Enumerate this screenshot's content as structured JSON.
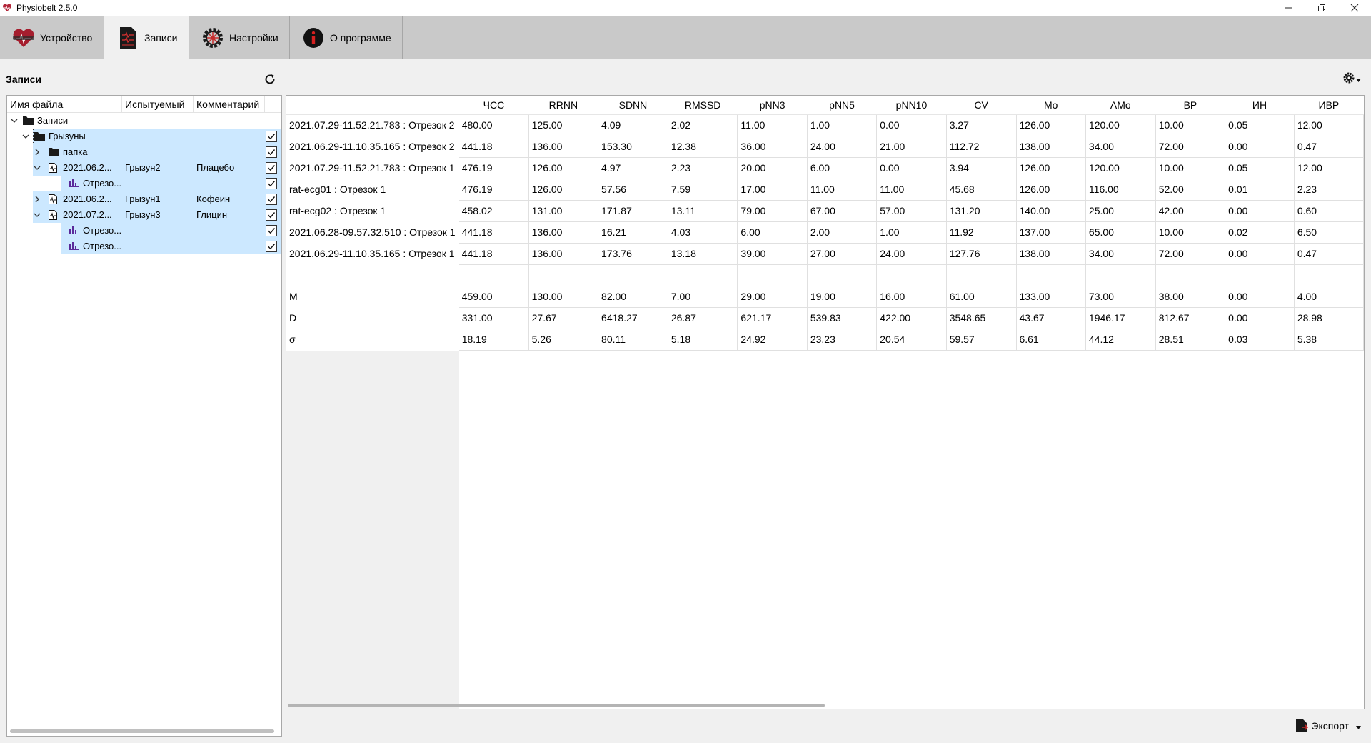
{
  "window": {
    "title": "Physiobelt 2.5.0"
  },
  "tabs": [
    {
      "label": "Устройство",
      "icon": "heart-icon",
      "active": false
    },
    {
      "label": "Записи",
      "icon": "ecg-document-icon",
      "active": true
    },
    {
      "label": "Настройки",
      "icon": "gear-wheel-icon",
      "active": false
    },
    {
      "label": "О программе",
      "icon": "info-icon",
      "active": false
    }
  ],
  "left": {
    "title": "Записи",
    "columns": [
      "Имя файла",
      "Испытуемый",
      "Комментарий"
    ],
    "rows": [
      {
        "name": "Записи",
        "subject": "",
        "comment": ""
      },
      {
        "name": "Грызуны",
        "subject": "",
        "comment": ""
      },
      {
        "name": "папка",
        "subject": "",
        "comment": ""
      },
      {
        "name": "2021.06.2...",
        "subject": "Грызун2",
        "comment": "Плацебо"
      },
      {
        "name": "Отрезо...",
        "subject": "",
        "comment": ""
      },
      {
        "name": "2021.06.2...",
        "subject": "Грызун1",
        "comment": "Кофеин"
      },
      {
        "name": "2021.07.2...",
        "subject": "Грызун3",
        "comment": "Глицин"
      },
      {
        "name": "Отрезо...",
        "subject": "",
        "comment": ""
      },
      {
        "name": "Отрезо...",
        "subject": "",
        "comment": ""
      }
    ]
  },
  "grid": {
    "columns": [
      "ЧСС",
      "RRNN",
      "SDNN",
      "RMSSD",
      "pNN3",
      "pNN5",
      "pNN10",
      "CV",
      "Mo",
      "AMo",
      "ВР",
      "ИН",
      "ИВР"
    ],
    "rows": [
      {
        "label": "2021.07.29-11.52.21.783 : Отрезок 2",
        "values": [
          "480.00",
          "125.00",
          "4.09",
          "2.02",
          "11.00",
          "1.00",
          "0.00",
          "3.27",
          "126.00",
          "120.00",
          "10.00",
          "0.05",
          "12.00"
        ]
      },
      {
        "label": "2021.06.29-11.10.35.165 : Отрезок 2",
        "values": [
          "441.18",
          "136.00",
          "153.30",
          "12.38",
          "36.00",
          "24.00",
          "21.00",
          "112.72",
          "138.00",
          "34.00",
          "72.00",
          "0.00",
          "0.47"
        ]
      },
      {
        "label": "2021.07.29-11.52.21.783 : Отрезок 1",
        "values": [
          "476.19",
          "126.00",
          "4.97",
          "2.23",
          "20.00",
          "6.00",
          "0.00",
          "3.94",
          "126.00",
          "120.00",
          "10.00",
          "0.05",
          "12.00"
        ]
      },
      {
        "label": "rat-ecg01 : Отрезок 1",
        "values": [
          "476.19",
          "126.00",
          "57.56",
          "7.59",
          "17.00",
          "11.00",
          "11.00",
          "45.68",
          "126.00",
          "116.00",
          "52.00",
          "0.01",
          "2.23"
        ]
      },
      {
        "label": "rat-ecg02 : Отрезок 1",
        "values": [
          "458.02",
          "131.00",
          "171.87",
          "13.11",
          "79.00",
          "67.00",
          "57.00",
          "131.20",
          "140.00",
          "25.00",
          "42.00",
          "0.00",
          "0.60"
        ]
      },
      {
        "label": "2021.06.28-09.57.32.510 : Отрезок 1",
        "values": [
          "441.18",
          "136.00",
          "16.21",
          "4.03",
          "6.00",
          "2.00",
          "1.00",
          "11.92",
          "137.00",
          "65.00",
          "10.00",
          "0.02",
          "6.50"
        ]
      },
      {
        "label": "2021.06.29-11.10.35.165 : Отрезок 1",
        "values": [
          "441.18",
          "136.00",
          "173.76",
          "13.18",
          "39.00",
          "27.00",
          "24.00",
          "127.76",
          "138.00",
          "34.00",
          "72.00",
          "0.00",
          "0.47"
        ]
      },
      {
        "label": "",
        "values": [
          "",
          "",
          "",
          "",
          "",
          "",
          "",
          "",
          "",
          "",
          "",
          "",
          ""
        ]
      },
      {
        "label": "M",
        "values": [
          "459.00",
          "130.00",
          "82.00",
          "7.00",
          "29.00",
          "19.00",
          "16.00",
          "61.00",
          "133.00",
          "73.00",
          "38.00",
          "0.00",
          "4.00"
        ]
      },
      {
        "label": "D",
        "values": [
          "331.00",
          "27.67",
          "6418.27",
          "26.87",
          "621.17",
          "539.83",
          "422.00",
          "3548.65",
          "43.67",
          "1946.17",
          "812.67",
          "0.00",
          "28.98"
        ]
      },
      {
        "label": "σ",
        "values": [
          "18.19",
          "5.26",
          "80.11",
          "5.18",
          "24.92",
          "23.23",
          "20.54",
          "59.57",
          "6.61",
          "44.12",
          "28.51",
          "0.03",
          "5.38"
        ]
      }
    ]
  },
  "footer": {
    "export_label": "Экспорт"
  }
}
